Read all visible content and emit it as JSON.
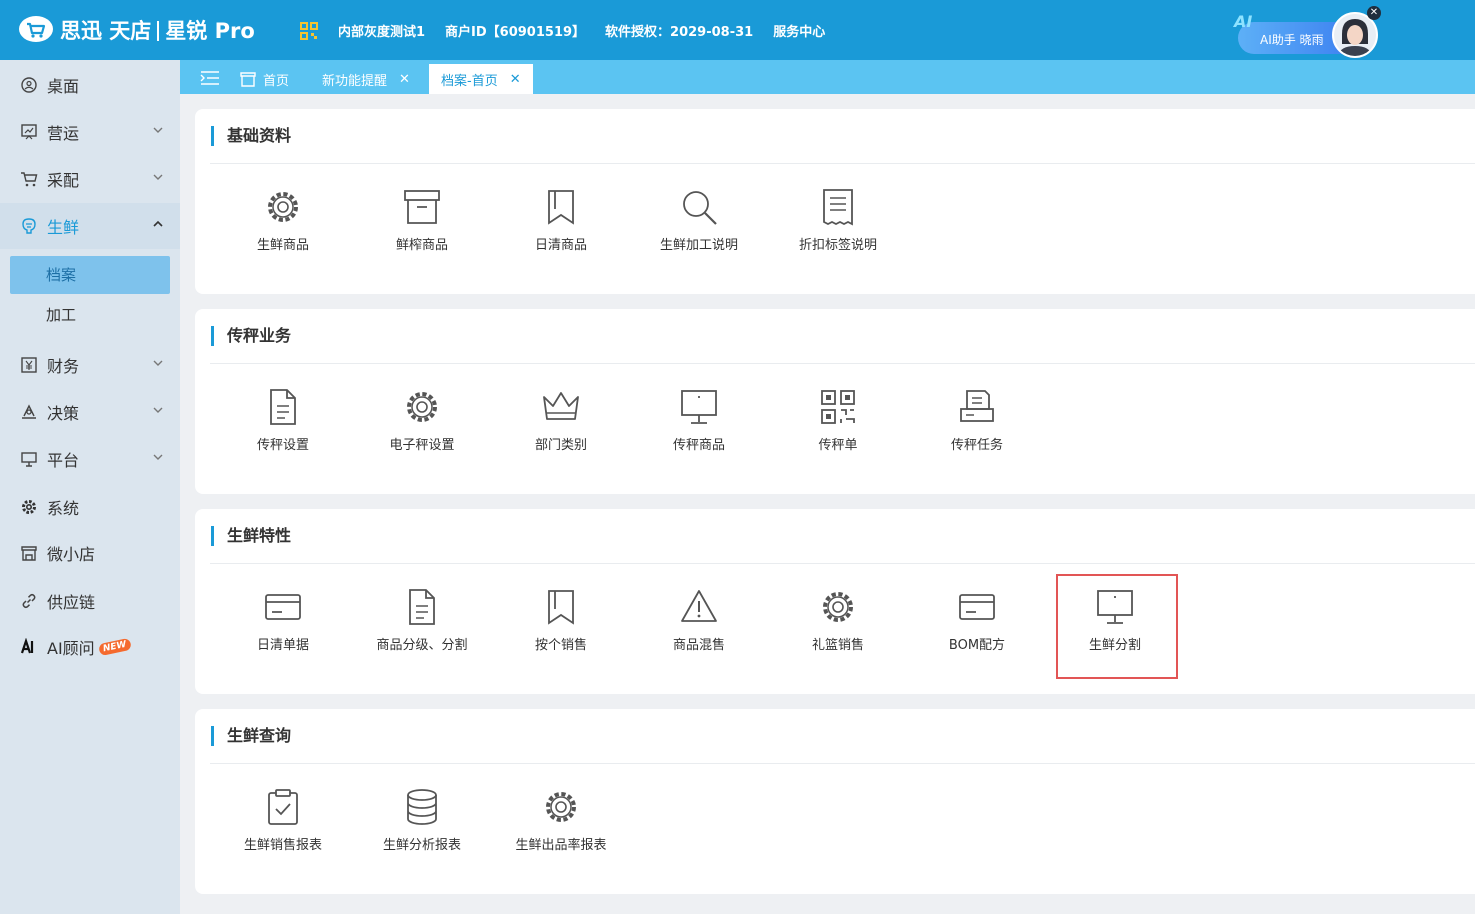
{
  "header": {
    "logo_text": "思迅 天店",
    "logo_product": "星锐 Pro",
    "info": [
      "内部灰度测试1",
      "商户ID【60901519】",
      "软件授权：2029-08-31",
      "服务中心"
    ],
    "ai_label": "AI助手 晓雨",
    "ai_badge": "AI",
    "close_symbol": "✕"
  },
  "sidebar": {
    "items": [
      {
        "label": "桌面",
        "icon": "desktop-icon"
      },
      {
        "label": "营运",
        "icon": "operations-icon"
      },
      {
        "label": "采配",
        "icon": "cart-icon"
      },
      {
        "label": "生鲜",
        "icon": "fresh-icon"
      },
      {
        "label": "财务",
        "icon": "finance-icon"
      },
      {
        "label": "决策",
        "icon": "decision-icon"
      },
      {
        "label": "平台",
        "icon": "platform-icon"
      },
      {
        "label": "系统",
        "icon": "gear-icon"
      },
      {
        "label": "微小店",
        "icon": "store-icon"
      },
      {
        "label": "供应链",
        "icon": "link-icon"
      },
      {
        "label": "AI顾问",
        "icon": "ai-icon"
      }
    ],
    "sub": [
      "档案",
      "加工"
    ],
    "new_tag": "NEW"
  },
  "tabs": [
    {
      "label": "首页"
    },
    {
      "label": "新功能提醒",
      "close": "✕"
    },
    {
      "label": "档案-首页",
      "close": "✕"
    }
  ],
  "sections": [
    {
      "title": "基础资料",
      "tiles": [
        "生鲜商品",
        "鲜榨商品",
        "日清商品",
        "生鲜加工说明",
        "折扣标签说明"
      ]
    },
    {
      "title": "传秤业务",
      "tiles": [
        "传秤设置",
        "电子秤设置",
        "部门类别",
        "传秤商品",
        "传秤单",
        "传秤任务"
      ]
    },
    {
      "title": "生鲜特性",
      "tiles": [
        "日清单据",
        "商品分级、分割",
        "按个销售",
        "商品混售",
        "礼篮销售",
        "BOM配方",
        "生鲜分割"
      ]
    },
    {
      "title": "生鲜查询",
      "tiles": [
        "生鲜销售报表",
        "生鲜分析报表",
        "生鲜出品率报表"
      ]
    }
  ],
  "colors": {
    "accent": "#1a9ad7",
    "tab_bar": "#5bc4f2",
    "highlight": "#e25555",
    "sidebar": "#dbe5ee"
  }
}
